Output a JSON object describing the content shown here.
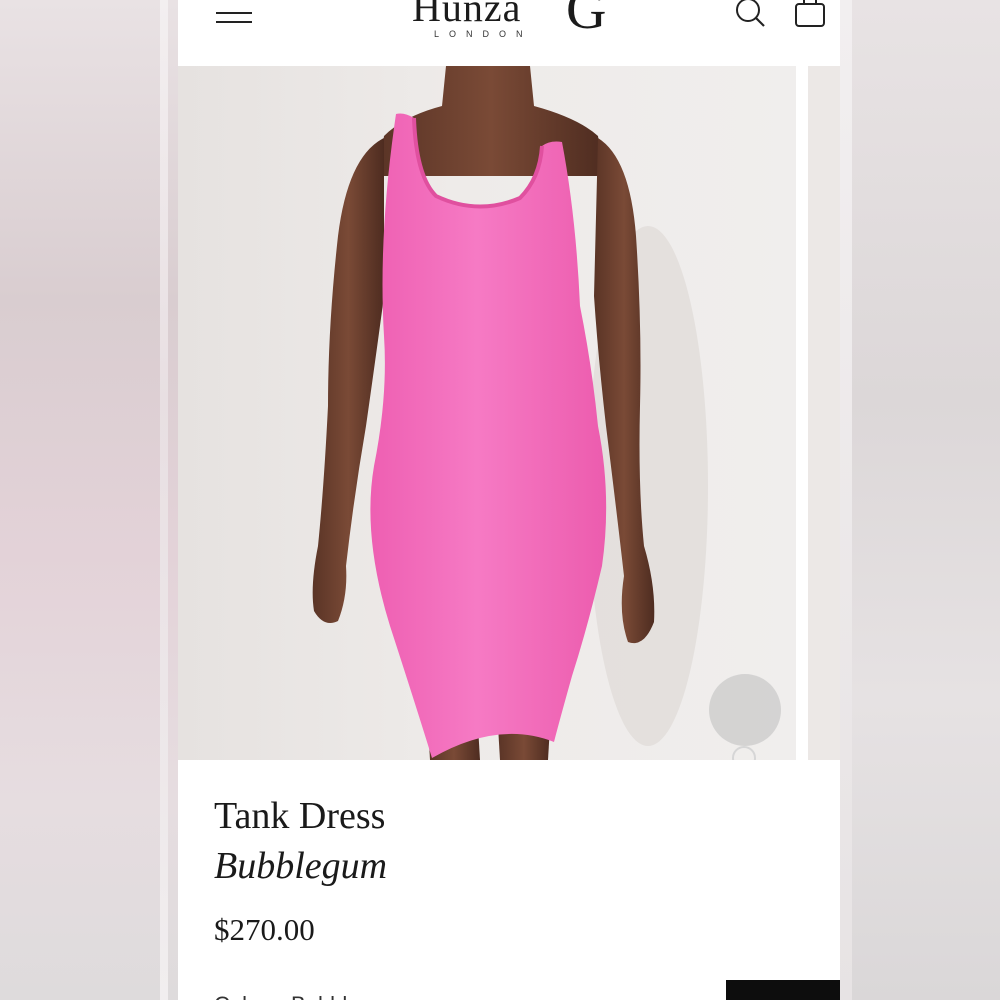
{
  "header": {
    "brand_name": "Hunza",
    "brand_initial": "G",
    "brand_location": "LONDON",
    "menu_icon": "hamburger-menu-icon",
    "search_icon": "search-icon",
    "bag_icon": "shopping-bag-icon"
  },
  "gallery": {
    "product_color_hex": "#f472be",
    "zoom_icon": "zoom-button",
    "indicator_icon": "carousel-dot-icon"
  },
  "product": {
    "name": "Tank Dress",
    "colorway": "Bubblegum",
    "price": "$270.00",
    "colour_line": "Colour: Bubblegum"
  },
  "cart": {
    "button_color": "#0d0d0d"
  }
}
